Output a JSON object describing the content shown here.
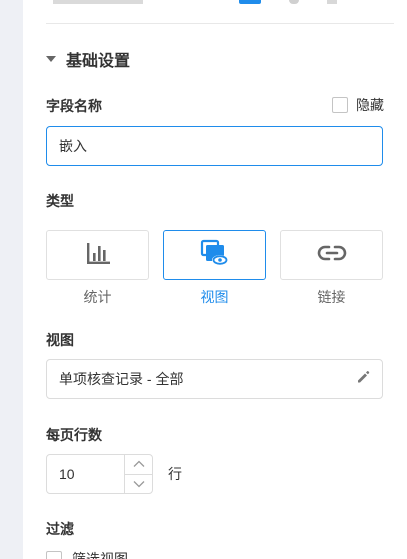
{
  "section": {
    "title": "基础设置"
  },
  "field_name": {
    "label": "字段名称",
    "value": "嵌入",
    "hide_label": "隐藏",
    "hide_checked": false
  },
  "type": {
    "label": "类型",
    "options": [
      {
        "label": "统计",
        "icon": "bar-chart-icon",
        "selected": false
      },
      {
        "label": "视图",
        "icon": "view-icon",
        "selected": true
      },
      {
        "label": "链接",
        "icon": "link-icon",
        "selected": false
      }
    ]
  },
  "view": {
    "label": "视图",
    "value": "单项核查记录 - 全部",
    "edit_icon": "pencil-icon"
  },
  "rows_per_page": {
    "label": "每页行数",
    "value": "10",
    "unit": "行"
  },
  "filter": {
    "label": "过滤",
    "checkbox_label": "筛选视图",
    "checked": false
  },
  "colors": {
    "accent": "#1f8ceb",
    "sidebar_bg": "#eef0f5",
    "border": "#dcdcdc",
    "text": "#333333",
    "muted": "#666666"
  }
}
